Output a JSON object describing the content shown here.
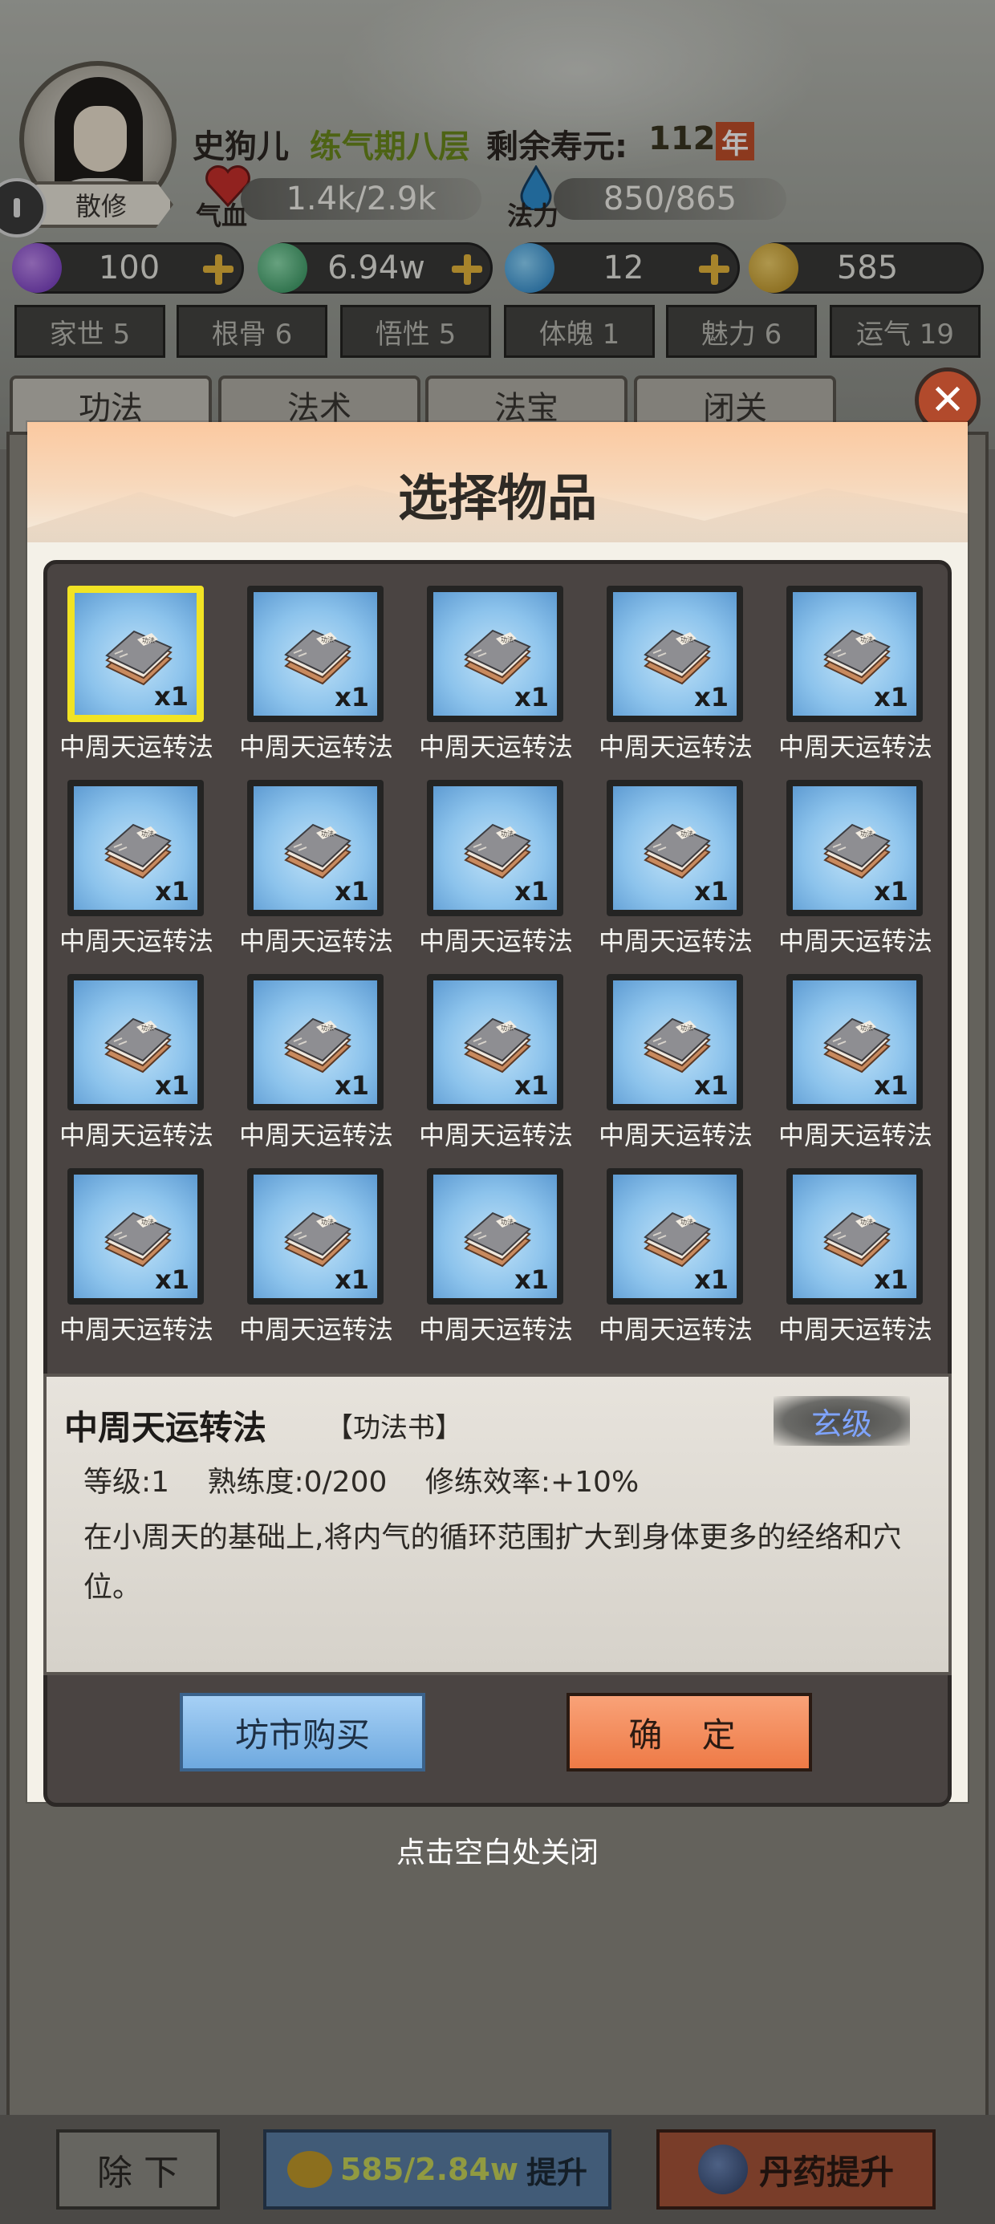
{
  "player": {
    "name": "史狗儿",
    "realm": "练气期八层",
    "lifespan_label": "剩余寿元:",
    "lifespan_value": "112",
    "lifespan_unit": "年",
    "rank": "散修",
    "hp_label": "气血",
    "hp_value": "1.4k/2.9k",
    "mp_label": "法力",
    "mp_value": "850/865"
  },
  "resources": [
    {
      "icon": "purple-gem-icon",
      "value": "100",
      "color": "#8a4fd6"
    },
    {
      "icon": "green-jade-icon",
      "value": "6.94w",
      "color": "#3aa86a"
    },
    {
      "icon": "blue-flame-icon",
      "value": "12",
      "color": "#2f9bd6"
    },
    {
      "icon": "gold-coin-icon",
      "value": "585",
      "color": "#d6a82f"
    }
  ],
  "attributes": [
    "家世 5",
    "根骨 6",
    "悟性 5",
    "体魄 1",
    "魅力 6",
    "运气 19"
  ],
  "tabs": [
    "功法",
    "法术",
    "法宝",
    "闭关"
  ],
  "modal": {
    "title": "选择物品",
    "items": [
      {
        "name": "中周天运转法",
        "qty": "x1"
      },
      {
        "name": "中周天运转法",
        "qty": "x1"
      },
      {
        "name": "中周天运转法",
        "qty": "x1"
      },
      {
        "name": "中周天运转法",
        "qty": "x1"
      },
      {
        "name": "中周天运转法",
        "qty": "x1"
      },
      {
        "name": "中周天运转法",
        "qty": "x1"
      },
      {
        "name": "中周天运转法",
        "qty": "x1"
      },
      {
        "name": "中周天运转法",
        "qty": "x1"
      },
      {
        "name": "中周天运转法",
        "qty": "x1"
      },
      {
        "name": "中周天运转法",
        "qty": "x1"
      },
      {
        "name": "中周天运转法",
        "qty": "x1"
      },
      {
        "name": "中周天运转法",
        "qty": "x1"
      },
      {
        "name": "中周天运转法",
        "qty": "x1"
      },
      {
        "name": "中周天运转法",
        "qty": "x1"
      },
      {
        "name": "中周天运转法",
        "qty": "x1"
      },
      {
        "name": "中周天运转法",
        "qty": "x1"
      },
      {
        "name": "中周天运转法",
        "qty": "x1"
      },
      {
        "name": "中周天运转法",
        "qty": "x1"
      },
      {
        "name": "中周天运转法",
        "qty": "x1"
      },
      {
        "name": "中周天运转法",
        "qty": "x1"
      }
    ],
    "book_title_text": "功法",
    "selected_index": 0,
    "detail": {
      "name": "中周天运转法",
      "type": "【功法书】",
      "grade": "玄级",
      "level": "等级:1",
      "proficiency": "熟练度:0/200",
      "efficiency": "修练效率:+10%",
      "description": "在小周天的基础上,将内气的循环范围扩大到身体更多的经络和穴位。"
    },
    "market_button": "坊市购买",
    "confirm_button": "确 定"
  },
  "close_hint": "点击空白处关闭",
  "bottom": {
    "remove_button": "除 下",
    "upgrade_cost": "585/2.84w",
    "upgrade_label": "提升",
    "pill_button": "丹药提升"
  }
}
